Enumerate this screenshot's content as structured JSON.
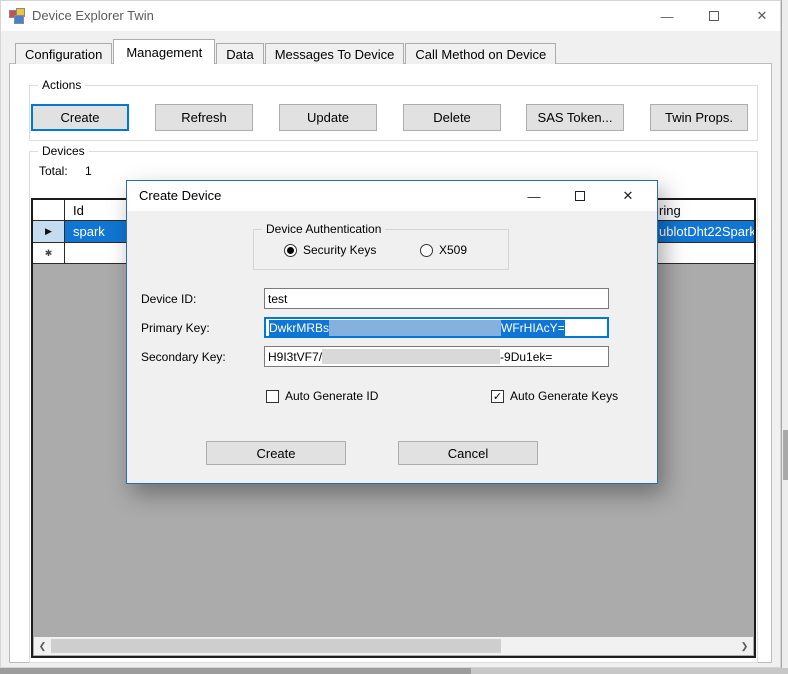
{
  "window": {
    "title": "Device Explorer Twin",
    "tabs": [
      {
        "label": "Configuration"
      },
      {
        "label": "Management"
      },
      {
        "label": "Data"
      },
      {
        "label": "Messages To Device"
      },
      {
        "label": "Call Method on Device"
      }
    ]
  },
  "actions": {
    "label": "Actions",
    "buttons": [
      "Create",
      "Refresh",
      "Update",
      "Delete",
      "SAS Token...",
      "Twin Props."
    ]
  },
  "devices": {
    "label": "Devices",
    "total_label": "Total:",
    "total_value": "1",
    "grid": {
      "id_header": "Id",
      "right_header_fragment": "ring",
      "selected_row_id": "spark",
      "selected_row_connection_fragment": "ublotDht22Spark.",
      "new_row_marker": "✱"
    }
  },
  "dialog": {
    "title": "Create Device",
    "auth": {
      "label": "Device Authentication",
      "option_security_keys": "Security Keys",
      "option_x509": "X509"
    },
    "device_id_label": "Device ID:",
    "device_id_value": "test",
    "primary_key_label": "Primary Key:",
    "primary_key_start": "DwkrMRBs",
    "primary_key_end": "WFrHIAcY=",
    "secondary_key_label": "Secondary Key:",
    "secondary_key_start": "H9I3tVF7/",
    "secondary_key_end": "-9Du1ek=",
    "auto_generate_id_label": "Auto Generate ID",
    "auto_generate_keys_label": "Auto Generate Keys",
    "create_button": "Create",
    "cancel_button": "Cancel"
  },
  "icons": {
    "minimize": "—",
    "close": "✕",
    "row_arrow": "▶",
    "scroll_left": "❮",
    "scroll_right": "❯",
    "check": "✓"
  },
  "colors": {
    "accent_blue": "#0078d7",
    "selection_blue": "#1176d3",
    "grid_background": "#ababab"
  }
}
